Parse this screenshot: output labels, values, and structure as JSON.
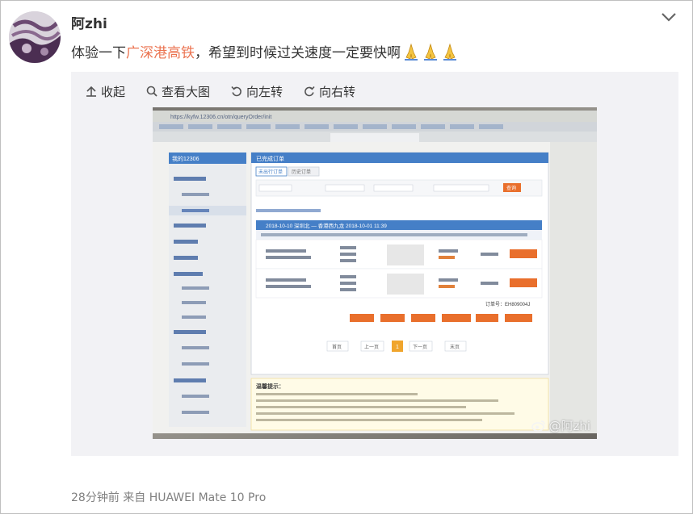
{
  "post": {
    "username": "阿zhi",
    "text_before": "体验一下",
    "topic_link": "广深港高铁",
    "text_after": "，希望到时候过关速度一定要快啊",
    "emoji_icons": [
      "praying-hands-icon",
      "praying-hands-icon",
      "praying-hands-icon"
    ],
    "footer": "28分钟前  来自 HUAWEI Mate 10 Pro"
  },
  "toolbar": {
    "collapse": "收起",
    "view_large": "查看大图",
    "rotate_left": "向左转",
    "rotate_right": "向右转"
  },
  "photo": {
    "watermark": "@阿zhi",
    "screen": {
      "url": "https://kyfw.12306.cn/otn/queryOrder/init",
      "site": "我的12306",
      "tab_label": "已完成订单",
      "tabs": [
        "未出行订单",
        "历史订单"
      ],
      "query_button": "查询",
      "journey": "2018-10-10 深圳北 — 香港西九龙 2018-10-01 11:39",
      "order_no": "订单号：EH809004J",
      "pagination": [
        "首页",
        "上一页",
        "1",
        "下一页",
        "末页"
      ],
      "notice_title": "温馨提示："
    }
  }
}
